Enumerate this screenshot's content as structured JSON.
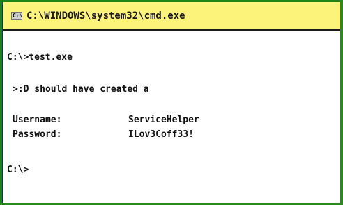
{
  "window": {
    "title": "C:\\WINDOWS\\system32\\cmd.exe",
    "icon": "console-icon",
    "icon_glyph": "C:\\"
  },
  "console": {
    "command_line": "C:\\>test.exe",
    "message": ">:D should have created a",
    "username_label": "Username:",
    "username_value": "ServiceHelper",
    "password_label": "Password:",
    "password_value": "ILov3Coff33!",
    "prompt": "C:\\>"
  },
  "colors": {
    "titlebar": "#fbf37a",
    "console_bg": "#ffffff",
    "text": "#111111",
    "desktop": "#23821a"
  }
}
